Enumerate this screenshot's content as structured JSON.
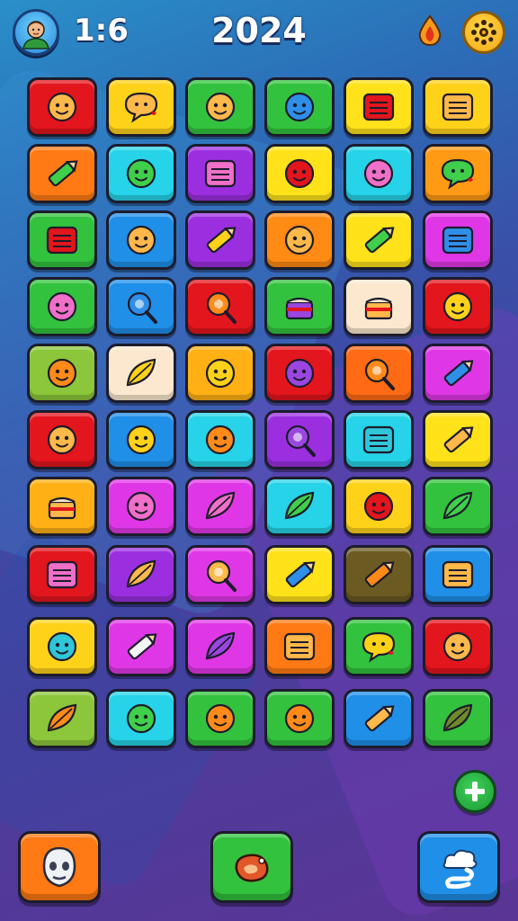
{
  "header": {
    "timer": "1:6",
    "score": "2024",
    "avatar_icon": "player-avatar-icon",
    "drop_icon": "water-drop-icon",
    "settings_icon": "gear-icon"
  },
  "board": {
    "upper_rows": [
      [
        {
          "color": "#e3151d",
          "icon": "smiley-icon"
        },
        {
          "color": "#ffd21a",
          "icon": "speech-bubble-heart-icon"
        },
        {
          "color": "#33c23e",
          "icon": "fish-face-icon"
        },
        {
          "color": "#33c23e",
          "icon": "blue-fish-icon"
        },
        {
          "color": "#ffe21a",
          "icon": "red-bag-icon"
        },
        {
          "color": "#ffd21a",
          "icon": "window-panel-icon"
        }
      ],
      [
        {
          "color": "#ff7a14",
          "icon": "green-pencil-icon"
        },
        {
          "color": "#26d3e8",
          "icon": "green-fish-icon"
        },
        {
          "color": "#9b2fe0",
          "icon": "pink-tag-icon"
        },
        {
          "color": "#ffe21a",
          "icon": "red-blob-icon"
        },
        {
          "color": "#26d3e8",
          "icon": "pink-strawberry-icon"
        },
        {
          "color": "#ff9a14",
          "icon": "green-speech-icon"
        }
      ],
      [
        {
          "color": "#33c23e",
          "icon": "red-list-icon"
        },
        {
          "color": "#1f8fe8",
          "icon": "acorn-icon"
        },
        {
          "color": "#9b2fe0",
          "icon": "yellow-pencil-icon"
        },
        {
          "color": "#ff8a14",
          "icon": "robot-icon"
        },
        {
          "color": "#ffe21a",
          "icon": "green-triangle-pencil-icon"
        },
        {
          "color": "#e037e6",
          "icon": "blue-list-icon"
        }
      ],
      [
        {
          "color": "#33c23e",
          "icon": "pink-berry-icon"
        },
        {
          "color": "#1f8fe8",
          "icon": "blue-lollipop-icon"
        },
        {
          "color": "#e3151d",
          "icon": "orange-ring-icon"
        },
        {
          "color": "#33c23e",
          "icon": "purple-cup-icon"
        },
        {
          "color": "#fbe8cf",
          "icon": "pancake-stack-icon"
        },
        {
          "color": "#e3151d",
          "icon": "yellow-face-icon"
        }
      ],
      [
        {
          "color": "#8cc63a",
          "icon": "orange-bird-icon"
        },
        {
          "color": "#fbe8cf",
          "icon": "yellow-banana-icon"
        },
        {
          "color": "#ffb014",
          "icon": "yellow-cat-icon"
        },
        {
          "color": "#e3151d",
          "icon": "purple-octopus-icon"
        },
        {
          "color": "#ff6a14",
          "icon": "orange-lollipop-icon"
        },
        {
          "color": "#e037e6",
          "icon": "blue-eraser-icon"
        }
      ],
      [
        {
          "color": "#e3151d",
          "icon": "tomato-icon"
        },
        {
          "color": "#1f8fe8",
          "icon": "yellow-chick-icon"
        },
        {
          "color": "#26d3e8",
          "icon": "orange-fish-heart-icon"
        },
        {
          "color": "#9b2fe0",
          "icon": "purple-lollipop-icon"
        },
        {
          "color": "#26d3e8",
          "icon": "teal-bag-icon"
        },
        {
          "color": "#ffe21a",
          "icon": "knife-icon"
        }
      ],
      [
        {
          "color": "#ffb014",
          "icon": "cake-icon"
        },
        {
          "color": "#e037e6",
          "icon": "pink-octopus-icon"
        },
        {
          "color": "#e037e6",
          "icon": "pink-radish-icon"
        },
        {
          "color": "#26d3e8",
          "icon": "green-pickle-icon"
        },
        {
          "color": "#ffd21a",
          "icon": "red-apple-icon"
        },
        {
          "color": "#33c23e",
          "icon": "green-bean-icon"
        }
      ]
    ],
    "lower_rows": [
      [
        {
          "color": "#e3151d",
          "icon": "pink-controller-icon"
        },
        {
          "color": "#9b2fe0",
          "icon": "leaf-icon"
        },
        {
          "color": "#e037e6",
          "icon": "magnifier-icon"
        },
        {
          "color": "#ffe21a",
          "icon": "blue-crayon-icon"
        },
        {
          "color": "#6b5a22",
          "icon": "orange-pencil-icon"
        },
        {
          "color": "#1f8fe8",
          "icon": "picture-frame-icon"
        }
      ],
      [
        {
          "color": "#ffd21a",
          "icon": "teal-fish-heart-icon"
        },
        {
          "color": "#e037e6",
          "icon": "white-crayon-icon"
        },
        {
          "color": "#e037e6",
          "icon": "purple-turnip-icon"
        },
        {
          "color": "#ff7a14",
          "icon": "calculator-icon"
        },
        {
          "color": "#33c23e",
          "icon": "yellow-speech-heart-icon"
        },
        {
          "color": "#e3151d",
          "icon": "spider-icon"
        }
      ],
      [
        {
          "color": "#8cc63a",
          "icon": "orange-feather-icon"
        },
        {
          "color": "#26d3e8",
          "icon": "green-frog-icon"
        },
        {
          "color": "#33c23e",
          "icon": "orange-crab-icon"
        },
        {
          "color": "#33c23e",
          "icon": "orange-cat-icon"
        },
        {
          "color": "#1f8fe8",
          "icon": "carrot-pencil-icon"
        },
        {
          "color": "#33c23e",
          "icon": "olive-icon"
        }
      ]
    ]
  },
  "controls": {
    "add_icon": "plus-icon",
    "left_button": {
      "color": "#ff7a14",
      "icon": "ghost-mask-icon"
    },
    "center_button": {
      "color": "#33c23e",
      "icon": "meat-steak-icon"
    },
    "right_button": {
      "color": "#1f8fe8",
      "icon": "cloud-swirl-icon"
    }
  }
}
